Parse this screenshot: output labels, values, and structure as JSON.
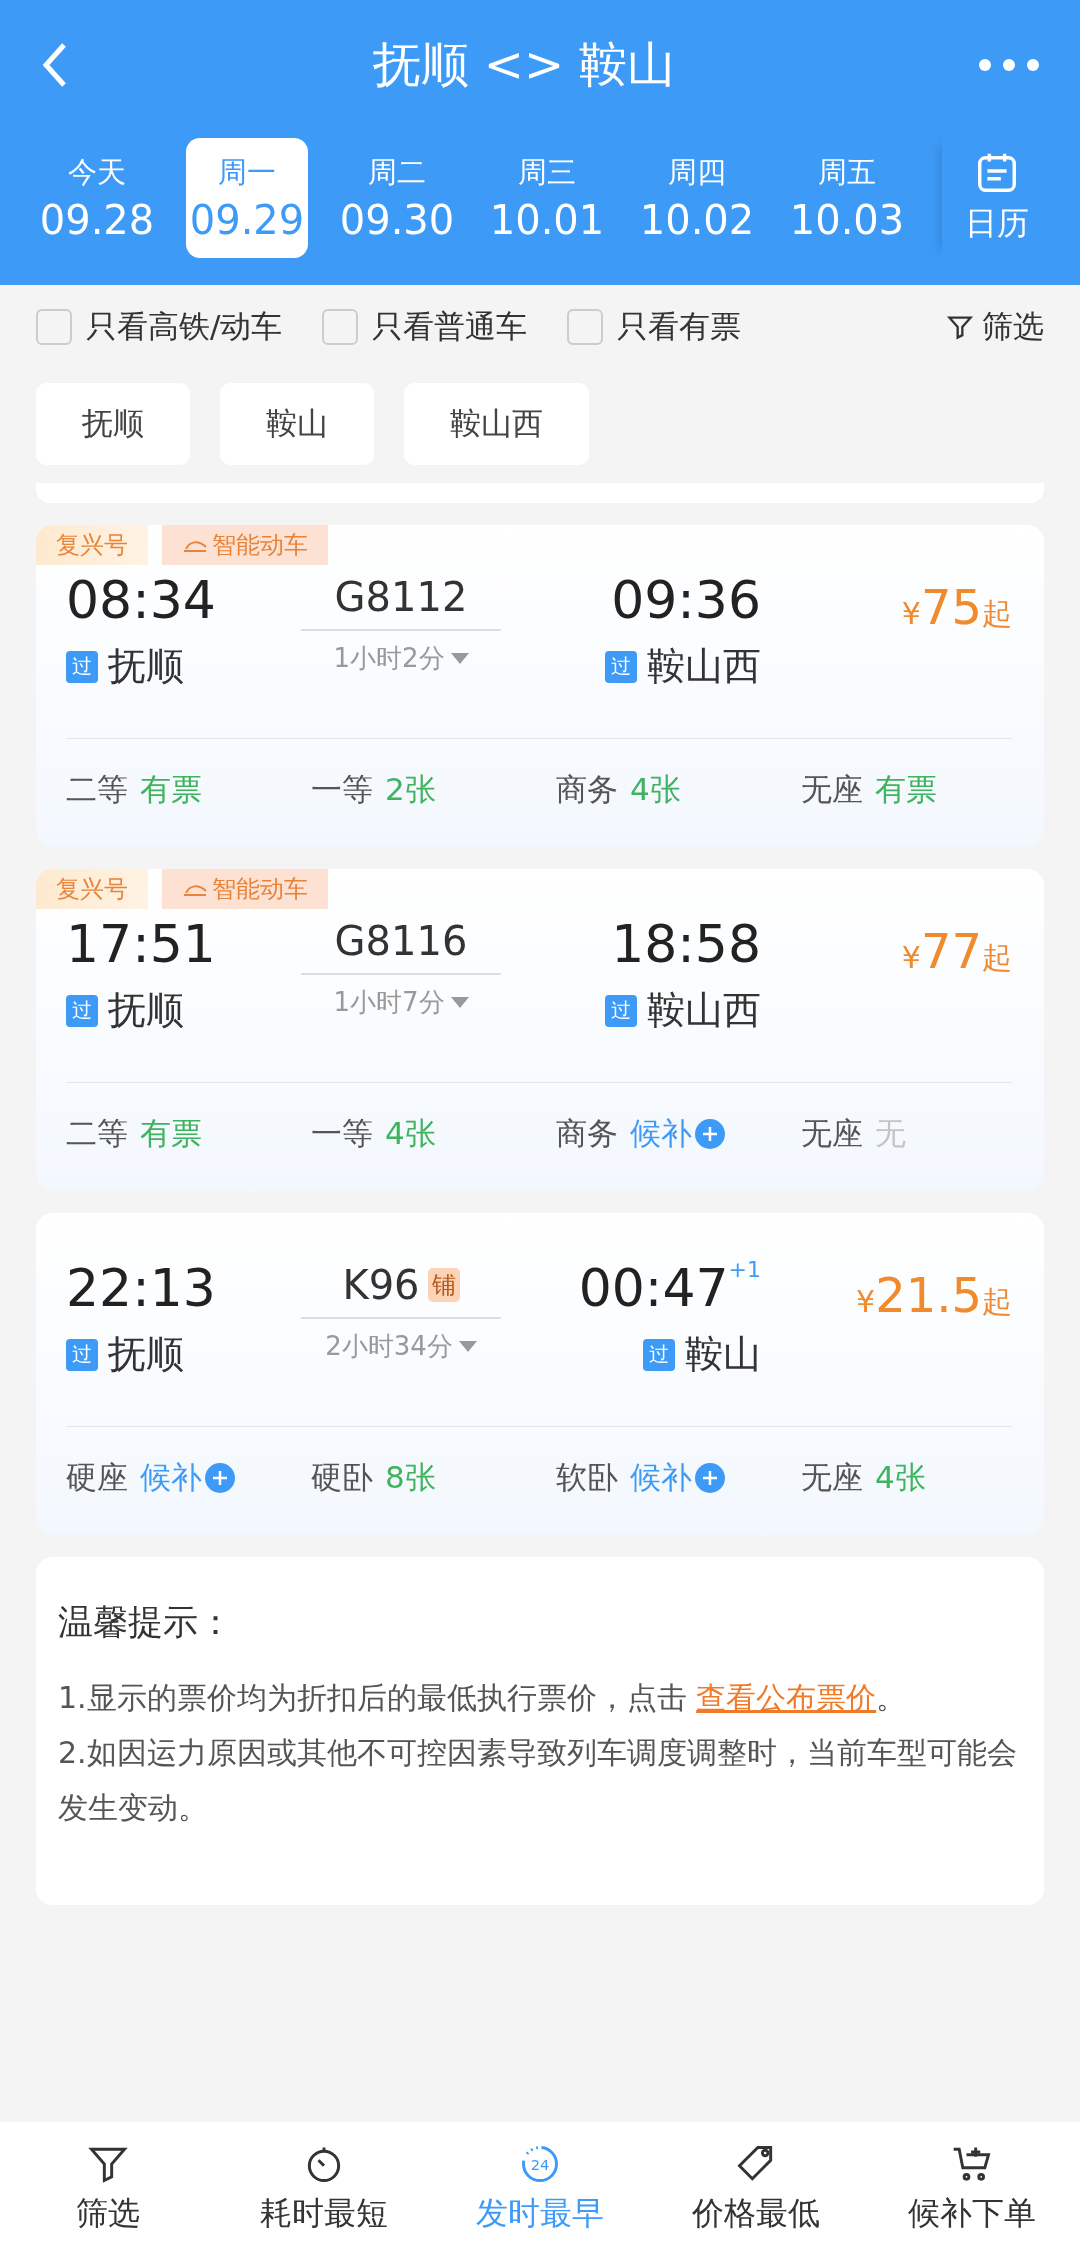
{
  "header": {
    "title": "抚顺 <> 鞍山",
    "calendar_label": "日历"
  },
  "dates": [
    {
      "weekday": "今天",
      "date": "09.28",
      "selected": false
    },
    {
      "weekday": "周一",
      "date": "09.29",
      "selected": true
    },
    {
      "weekday": "周二",
      "date": "09.30",
      "selected": false
    },
    {
      "weekday": "周三",
      "date": "10.01",
      "selected": false
    },
    {
      "weekday": "周四",
      "date": "10.02",
      "selected": false
    },
    {
      "weekday": "周五",
      "date": "10.03",
      "selected": false
    }
  ],
  "filters": [
    {
      "label": "只看高铁/动车",
      "checked": false
    },
    {
      "label": "只看普通车",
      "checked": false
    },
    {
      "label": "只看有票",
      "checked": false
    }
  ],
  "filter_button": "筛选",
  "stations": [
    "抚顺",
    "鞍山",
    "鞍山西"
  ],
  "trains": [
    {
      "tags": [
        "复兴号",
        "智能动车"
      ],
      "depart_time": "08:34",
      "train_no": "G8112",
      "duration": "1小时2分",
      "arrive_time": "09:36",
      "from_mark": "过",
      "from": "抚顺",
      "to_mark": "过",
      "to": "鞍山西",
      "price_symbol": "¥",
      "price": "75",
      "price_suffix": "起",
      "seats": [
        {
          "class": "二等",
          "status": "有票",
          "kind": "available"
        },
        {
          "class": "一等",
          "status": "2张",
          "kind": "available"
        },
        {
          "class": "商务",
          "status": "4张",
          "kind": "available"
        },
        {
          "class": "无座",
          "status": "有票",
          "kind": "available"
        }
      ]
    },
    {
      "tags": [
        "复兴号",
        "智能动车"
      ],
      "depart_time": "17:51",
      "train_no": "G8116",
      "duration": "1小时7分",
      "arrive_time": "18:58",
      "from_mark": "过",
      "from": "抚顺",
      "to_mark": "过",
      "to": "鞍山西",
      "price_symbol": "¥",
      "price": "77",
      "price_suffix": "起",
      "seats": [
        {
          "class": "二等",
          "status": "有票",
          "kind": "available"
        },
        {
          "class": "一等",
          "status": "4张",
          "kind": "available"
        },
        {
          "class": "商务",
          "status": "候补",
          "kind": "waitlist"
        },
        {
          "class": "无座",
          "status": "无",
          "kind": "none"
        }
      ]
    },
    {
      "depart_time": "22:13",
      "train_no": "K96",
      "train_badge": "铺",
      "duration": "2小时34分",
      "arrive_time": "00:47",
      "day_offset": "+1",
      "from_mark": "过",
      "from": "抚顺",
      "to_mark": "过",
      "to": "鞍山",
      "price_symbol": "¥",
      "price": "21.5",
      "price_suffix": "起",
      "seats": [
        {
          "class": "硬座",
          "status": "候补",
          "kind": "waitlist"
        },
        {
          "class": "硬卧",
          "status": "8张",
          "kind": "available"
        },
        {
          "class": "软卧",
          "status": "候补",
          "kind": "waitlist"
        },
        {
          "class": "无座",
          "status": "4张",
          "kind": "available"
        }
      ]
    }
  ],
  "tips": {
    "title": "温馨提示：",
    "line_1": "1.显示的票价均为折扣后的最低执行票价，点击 ",
    "link": "查看公布票价",
    "line_1_end": "。",
    "line_2": "2.如因运力原因或其他不可控因素导致列车调度调整时，当前车型可能会发生变动。"
  },
  "bottom_nav": [
    {
      "label": "筛选",
      "selected": false
    },
    {
      "label": "耗时最短",
      "selected": false
    },
    {
      "label": "发时最早",
      "icon_text": "24",
      "selected": true
    },
    {
      "label": "价格最低",
      "selected": false
    },
    {
      "label": "候补下单",
      "selected": false
    }
  ]
}
